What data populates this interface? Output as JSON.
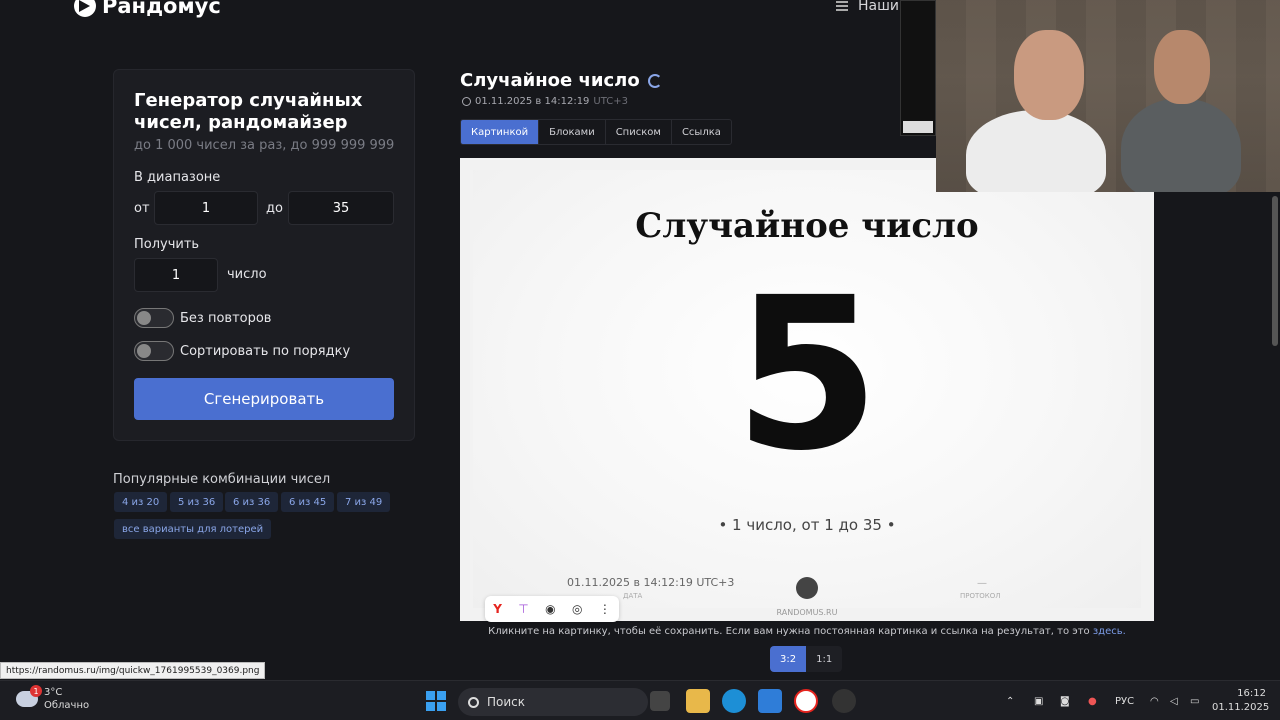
{
  "header": {
    "logo": "Рандомус",
    "menu_label": "Наши"
  },
  "form": {
    "title": "Генератор случайных чисел, рандомайзер",
    "subtitle": "до 1 000 чисел за раз, до 999 999 999",
    "range_label": "В диапазоне",
    "from_label": "от",
    "from_value": "1",
    "to_label": "до",
    "to_value": "35",
    "get_label": "Получить",
    "count_value": "1",
    "count_unit": "число",
    "no_repeat_label": "Без повторов",
    "no_repeat_on": false,
    "sort_label": "Сортировать по порядку",
    "sort_on": false,
    "generate_button": "Сгенерировать"
  },
  "popular": {
    "title": "Популярные комбинации чисел",
    "chips": [
      "4 из 20",
      "5 из 36",
      "6 из 36",
      "6 из 45",
      "7 из 49"
    ],
    "all_lotteries": "все варианты для лотерей"
  },
  "result": {
    "title": "Случайное число",
    "date": "01.11.2025 в 14:12:19",
    "tz": "UTC+3",
    "tabs": [
      "Картинкой",
      "Блоками",
      "Списком",
      "Ссылка"
    ],
    "active_tab": "Картинкой",
    "image": {
      "title": "Случайное число",
      "number": "5",
      "description": "•  1 число, от 1 до 35  •",
      "date": "01.11.2025 в 14:12:19 UTC+3",
      "date_label": "ДАТА",
      "site": "RANDOMUS.RU",
      "protocol_label": "ПРОТОКОЛ",
      "protocol_value": "—"
    },
    "note_text": "Кликните на картинку, чтобы её сохранить. Если вам нужна постоянная картинка и ссылка на результат, то это",
    "note_link": "здесь.",
    "ratios": [
      "3:2",
      "1:1"
    ],
    "active_ratio": "3:2"
  },
  "status_url": "https://randomus.ru/img/quickw_1761995539_0369.png",
  "taskbar": {
    "weather_temp": "3°C",
    "weather_desc": "Облачно",
    "weather_badge": "1",
    "search_placeholder": "Поиск",
    "lang": "РУС",
    "time": "16:12",
    "date": "01.11.2025"
  },
  "colors": {
    "accent": "#4a6fd0",
    "background": "#16171b",
    "card": "#1c1d22"
  }
}
